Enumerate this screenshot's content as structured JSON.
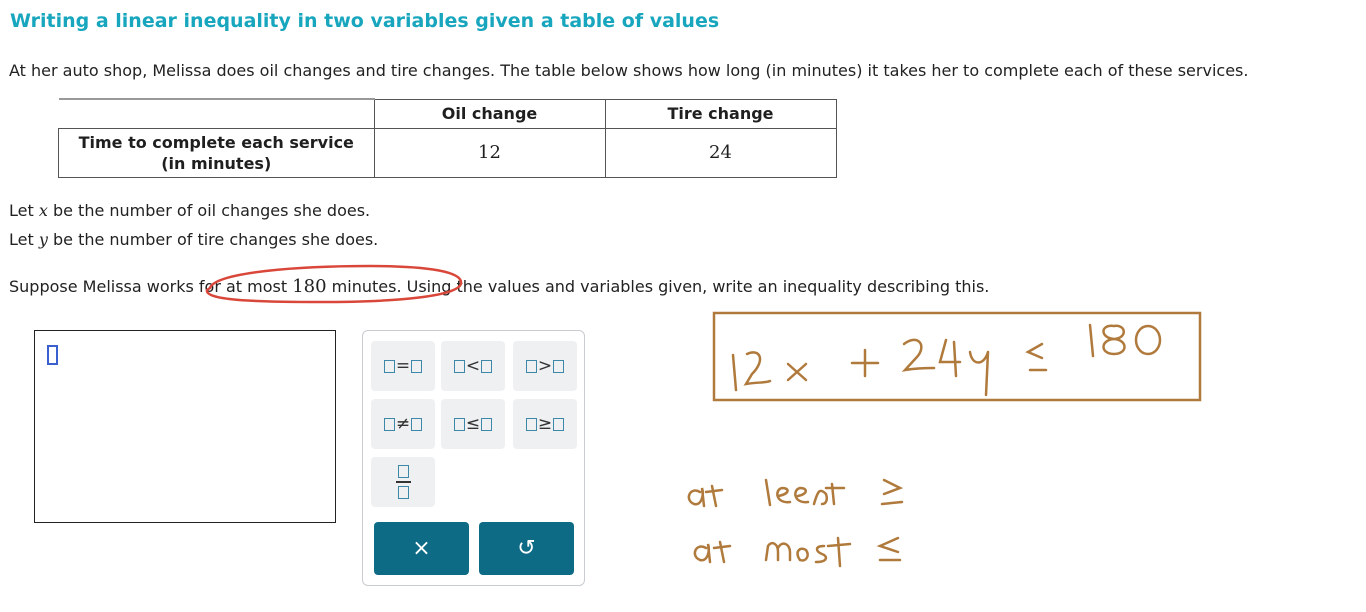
{
  "title": "Writing a linear inequality in two variables given a table of values",
  "intro": "At her auto shop, Melissa does oil changes and tire changes. The table below shows how long (in minutes) it takes her to complete each of these services.",
  "table": {
    "columns": [
      "Oil change",
      "Tire change"
    ],
    "row_header_line1": "Time to complete each service",
    "row_header_line2": "(in minutes)",
    "values": [
      "12",
      "24"
    ]
  },
  "let_x": {
    "pre": "Let ",
    "var": "x",
    "post": " be the number of oil changes she does."
  },
  "let_y": {
    "pre": "Let ",
    "var": "y",
    "post": " be the number of tire changes she does."
  },
  "question": {
    "pre": "Suppose Melissa works for at most ",
    "num": "180",
    "post": " minutes. Using the values and variables given, write an inequality describing this."
  },
  "keypad": {
    "keys": [
      {
        "name": "equals-key",
        "op": "="
      },
      {
        "name": "less-than-key",
        "op": "<"
      },
      {
        "name": "greater-than-key",
        "op": ">"
      },
      {
        "name": "not-equal-key",
        "op": "≠"
      },
      {
        "name": "less-equal-key",
        "op": "≤"
      },
      {
        "name": "greater-equal-key",
        "op": "≥"
      }
    ],
    "clear_symbol": "×",
    "undo_symbol": "↺"
  },
  "annotations": {
    "written_answer": "12x + 24y ≤ 180",
    "note_at_least": "at least ≥",
    "note_at_most": "at most ≤",
    "ink_red": "#d9473a",
    "ink_brown": "#b07a3c",
    "accent_teal": "#0d6b85",
    "title_color": "#17a6bd"
  }
}
